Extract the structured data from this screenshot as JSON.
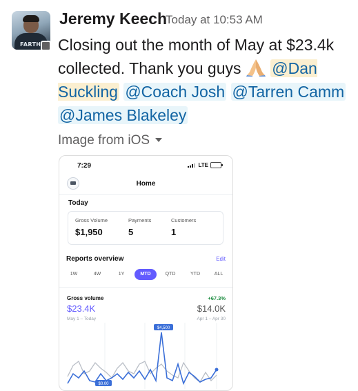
{
  "message": {
    "author": "Jeremy Keech",
    "timestamp": "Today at 10:53 AM",
    "avatar_text": "FARTHER",
    "text_1": "Closing out the month of May at $23.4k collected. Thank you guys",
    "emoji": "folded-hands",
    "mentions": [
      "@Dan Suckling",
      "@Coach Josh",
      "@Tarren Camm",
      "@James Blakeley"
    ],
    "attachment_label": "Image from iOS"
  },
  "phone": {
    "time": "7:29",
    "network": "LTE",
    "title": "Home",
    "today_label": "Today",
    "metrics": [
      {
        "label": "Gross Volume",
        "value": "$1,950"
      },
      {
        "label": "Payments",
        "value": "5"
      },
      {
        "label": "Customers",
        "value": "1"
      }
    ],
    "reports_title": "Reports overview",
    "edit_label": "Edit",
    "ranges": [
      "1W",
      "4W",
      "1Y",
      "MTD",
      "QTD",
      "YTD",
      "ALL"
    ],
    "selected_range": "MTD",
    "gross_label": "Gross volume",
    "change": "+67.3%",
    "current_value": "$23.4K",
    "previous_value": "$14.0K",
    "current_range": "May 1 – Today",
    "previous_range": "Apr 1 – Apr 30",
    "accent_color": "#635bff",
    "chart_labels": {
      "peak": "$4,500",
      "low": "$0.00"
    }
  }
}
